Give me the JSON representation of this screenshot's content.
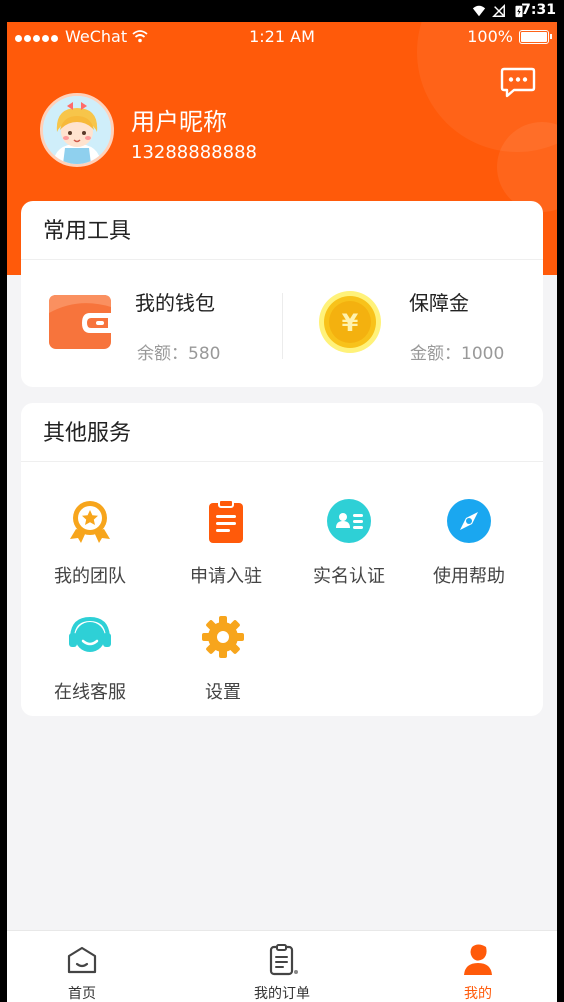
{
  "android_status": {
    "time": "7:31"
  },
  "ios_status": {
    "carrier": "WeChat",
    "time": "1:21 AM",
    "battery": "100%"
  },
  "profile": {
    "nickname": "用户昵称",
    "phone": "13288888888"
  },
  "tools": {
    "title": "常用工具",
    "wallet": {
      "name": "我的钱包",
      "sub": "余额：580"
    },
    "deposit": {
      "name": "保障金",
      "sub": "金额：1000"
    }
  },
  "services": {
    "title": "其他服务",
    "items": [
      {
        "label": "我的团队",
        "icon": "medal-icon"
      },
      {
        "label": "申请入驻",
        "icon": "clipboard-icon"
      },
      {
        "label": "实名认证",
        "icon": "id-card-icon"
      },
      {
        "label": "使用帮助",
        "icon": "compass-icon"
      },
      {
        "label": "在线客服",
        "icon": "headset-icon"
      },
      {
        "label": "设置",
        "icon": "gear-icon"
      }
    ]
  },
  "tabbar": {
    "items": [
      {
        "label": "首页",
        "icon": "home-icon"
      },
      {
        "label": "我的订单",
        "icon": "order-icon"
      },
      {
        "label": "我的",
        "icon": "user-icon",
        "active": true
      }
    ]
  },
  "colors": {
    "primary": "#ff5a0a",
    "wallet": "#f7743c",
    "coin": "#f8c21a",
    "teal": "#2ed0d6",
    "blue": "#1aa7f0"
  }
}
